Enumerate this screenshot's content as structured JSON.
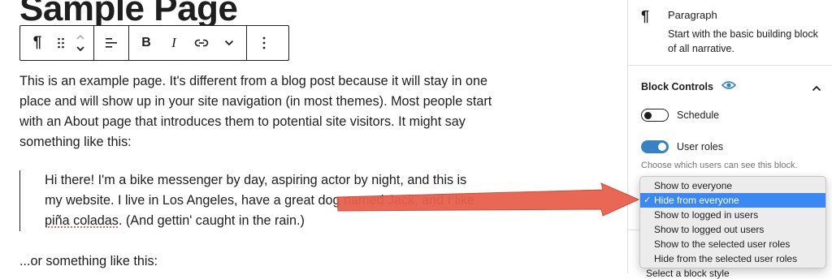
{
  "editor": {
    "page_title": "Sample Page",
    "paragraph": "This is an example page. It's different from a blog post because it will stay in one place and will show up in your site navigation (in most themes). Most people start with an About page that introduces them to potential site visitors. It might say something like this:",
    "quote_lines": [
      "Hi there! I'm a bike messenger by day, aspiring actor by night, and this is",
      "my website. I live in Los Angeles, have a great dog named Jack, and I like"
    ],
    "quote_last_misspelled": "piña coladas",
    "quote_last_rest": ". (And gettin' caught in the rain.)",
    "after_text": "...or something like this:"
  },
  "toolbar": {
    "icons": [
      "paragraph-icon",
      "drag-handle-icon",
      "move-up-down-icon",
      "align-icon",
      "bold-icon",
      "italic-icon",
      "link-icon",
      "chevron-down-icon",
      "more-options-icon"
    ],
    "bold_label": "B",
    "italic_label": "I",
    "paragraph_glyph": "¶"
  },
  "sidebar": {
    "block": {
      "icon_glyph": "¶",
      "title": "Paragraph",
      "description": "Start with the basic building block of all narrative."
    },
    "block_controls": {
      "title": "Block Controls",
      "schedule_label": "Schedule",
      "schedule_on": false,
      "user_roles_label": "User roles",
      "user_roles_on": true,
      "help_text": "Choose which users can see this block."
    },
    "dropdown": {
      "options": [
        "Show to everyone",
        "Hide from everyone",
        "Show to logged in users",
        "Show to logged out users",
        "Show to the selected user roles",
        "Hide from the selected user roles"
      ],
      "selected_index": 1,
      "check_glyph": "✓"
    },
    "below_select_text": "Select a block style"
  },
  "colors": {
    "accent": "#3582c4",
    "selected_option": "#3b88f5",
    "arrow": "#e8604c",
    "text": "#1e1e1e",
    "help_text": "#757575"
  }
}
